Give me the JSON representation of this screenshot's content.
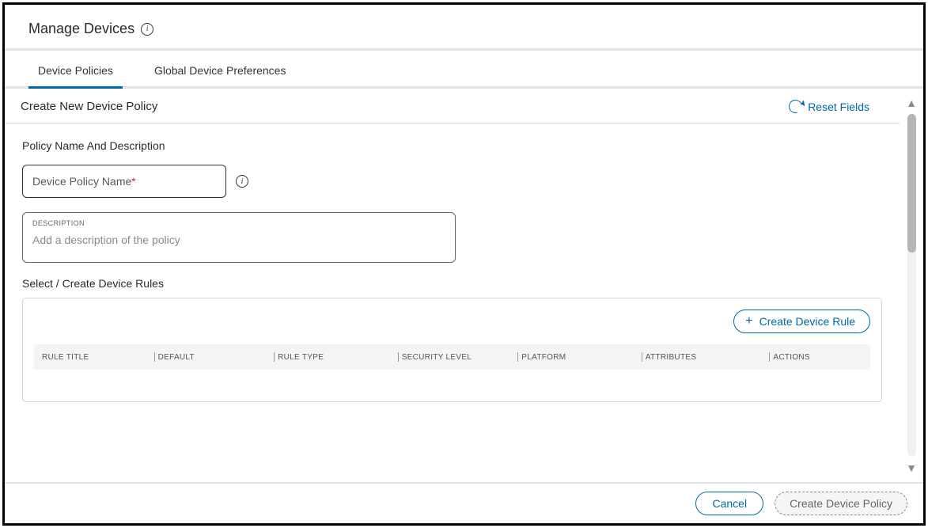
{
  "header": {
    "title": "Manage Devices"
  },
  "tabs": {
    "items": [
      {
        "label": "Device Policies",
        "active": true
      },
      {
        "label": "Global Device Preferences",
        "active": false
      }
    ]
  },
  "section": {
    "title": "Create New Device Policy",
    "reset_label": "Reset Fields"
  },
  "form": {
    "name_desc_heading": "Policy Name And Description",
    "policy_name_label": "Device Policy Name",
    "description_label": "DESCRIPTION",
    "description_placeholder": "Add a description of the policy",
    "rules_heading": "Select / Create Device Rules",
    "create_rule_label": "Create Device Rule",
    "columns": {
      "rule_title": "RULE TITLE",
      "default": "DEFAULT",
      "rule_type": "RULE TYPE",
      "security_level": "SECURITY LEVEL",
      "platform": "PLATFORM",
      "attributes": "ATTRIBUTES",
      "actions": "ACTIONS"
    }
  },
  "footer": {
    "cancel_label": "Cancel",
    "create_policy_label": "Create Device Policy"
  }
}
